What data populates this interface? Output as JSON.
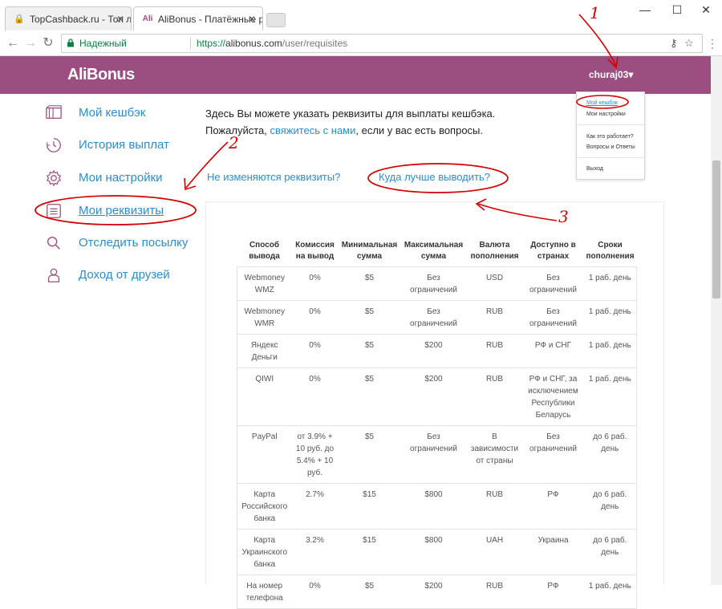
{
  "browser": {
    "tabs": [
      {
        "title": "TopCashback.ru - Топ лу",
        "active": false
      },
      {
        "title": "AliBonus - Платёжные р",
        "active": true
      }
    ],
    "secure_label": "Надежный",
    "url_scheme": "https://",
    "url_host": "alibonus.com",
    "url_path": "/user/requisites"
  },
  "header": {
    "logo": "AliBonus",
    "username": "churaj03▾"
  },
  "dropdown": {
    "items": [
      "Мой кешбэк",
      "Мои настройки",
      "Как это работает?",
      "Вопросы и Ответы",
      "Выход"
    ]
  },
  "sidebar": {
    "items": [
      {
        "label": "Мой кешбэк",
        "icon": "wallet-icon"
      },
      {
        "label": "История выплат",
        "icon": "clock-icon"
      },
      {
        "label": "Мои настройки",
        "icon": "gear-icon"
      },
      {
        "label": "Мои реквизиты",
        "icon": "document-icon"
      },
      {
        "label": "Отследить посылку",
        "icon": "search-icon"
      },
      {
        "label": "Доход от друзей",
        "icon": "person-icon"
      }
    ]
  },
  "intro": {
    "line1": "Здесь Вы можете указать реквизиты для выплаты кешбэка.",
    "line2_before": "Пожалуйста, ",
    "line2_link": "свяжитесь с нами",
    "line2_after": ", если у вас есть вопросы."
  },
  "links": {
    "unchanged": "Не изменяются реквизиты?",
    "best_way": "Куда лучше выводить?"
  },
  "table": {
    "headers": [
      "Способ вывода",
      "Комиссия на вывод",
      "Минимальная сумма",
      "Максимальная сумма",
      "Валюта пополнения",
      "Доступно в странах",
      "Сроки пополнения"
    ],
    "rows": [
      [
        "Webmoney WMZ",
        "0%",
        "$5",
        "Без ограничений",
        "USD",
        "Без ограничений",
        "1 раб. день"
      ],
      [
        "Webmoney WMR",
        "0%",
        "$5",
        "Без ограничений",
        "RUB",
        "Без ограничений",
        "1 раб. день"
      ],
      [
        "Яндекс Деньги",
        "0%",
        "$5",
        "$200",
        "RUB",
        "РФ и СНГ",
        "1 раб. день"
      ],
      [
        "QIWI",
        "0%",
        "$5",
        "$200",
        "RUB",
        "РФ и СНГ, за исключением Республики Беларусь",
        "1 раб. день"
      ],
      [
        "PayPal",
        "от 3.9% + 10 руб. до 5.4% + 10 руб.",
        "$5",
        "Без ограничений",
        "В зависимости от страны",
        "Без ограничений",
        "до 6 раб. день"
      ],
      [
        "Карта Российского банка",
        "2.7%",
        "$15",
        "$800",
        "RUB",
        "РФ",
        "до 6 раб. день"
      ],
      [
        "Карта Украинского банка",
        "3.2%",
        "$15",
        "$800",
        "UAH",
        "Украина",
        "до 6 раб. день"
      ],
      [
        "На номер телефона",
        "0%",
        "$5",
        "$200",
        "RUB",
        "РФ",
        "1 раб. день"
      ]
    ]
  },
  "annotations": {
    "n1": "1",
    "n2": "2",
    "n3": "3"
  }
}
